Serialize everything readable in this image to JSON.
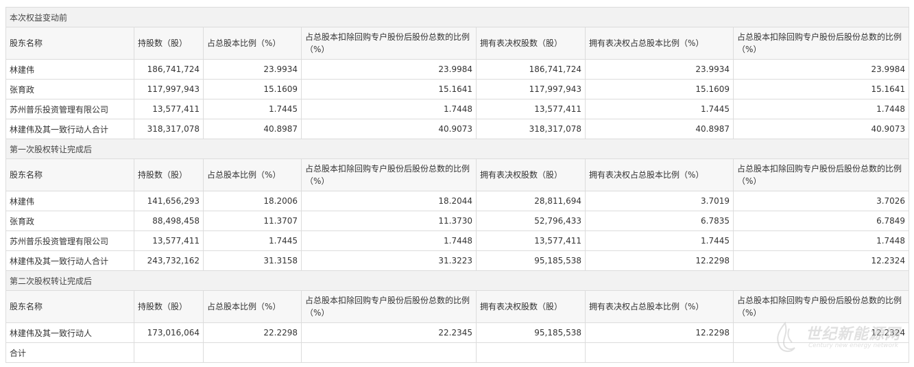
{
  "columns": [
    "股东名称",
    "持股数（股）",
    "占总股本比例（%）",
    "占总股本扣除回购专户股份后股份总数的比例（%）",
    "拥有表决权股数（股）",
    "拥有表决权占总股本比例（%）",
    "占总股本扣除回购专户股份后股份总数的比例（%）"
  ],
  "sections": [
    {
      "title": "本次权益变动前",
      "rows": [
        [
          "林建伟",
          "186,741,724",
          "23.9934",
          "23.9984",
          "186,741,724",
          "23.9934",
          "23.9984"
        ],
        [
          "张育政",
          "117,997,943",
          "15.1609",
          "15.1641",
          "117,997,943",
          "15.1609",
          "15.1641"
        ],
        [
          "苏州普乐投资管理有限公司",
          "13,577,411",
          "1.7445",
          "1.7448",
          "13,577,411",
          "1.7445",
          "1.7448"
        ],
        [
          "林建伟及其一致行动人合计",
          "318,317,078",
          "40.8987",
          "40.9073",
          "318,317,078",
          "40.8987",
          "40.9073"
        ]
      ]
    },
    {
      "title": "第一次股权转让完成后",
      "rows": [
        [
          "林建伟",
          "141,656,293",
          "18.2006",
          "18.2044",
          "28,811,694",
          "3.7019",
          "3.7026"
        ],
        [
          "张育政",
          "88,498,458",
          "11.3707",
          "11.3730",
          "52,796,433",
          "6.7835",
          "6.7849"
        ],
        [
          "苏州普乐投资管理有限公司",
          "13,577,411",
          "1.7445",
          "1.7448",
          "13,577,411",
          "1.7445",
          "1.7448"
        ],
        [
          "林建伟及其一致行动人合计",
          "243,732,162",
          "31.3158",
          "31.3223",
          "95,185,538",
          "12.2298",
          "12.2324"
        ]
      ]
    },
    {
      "title": "第二次股权转让完成后",
      "rows": [
        [
          "林建伟及其一致行动人",
          "173,016,064",
          "22.2298",
          "22.2345",
          "95,185,538",
          "12.2298",
          "12.2324"
        ],
        [
          "合计",
          "",
          "",
          "",
          "",
          "",
          ""
        ]
      ]
    }
  ],
  "watermark": {
    "title": "世纪新能源网",
    "subtitle": "Century new energy network"
  }
}
